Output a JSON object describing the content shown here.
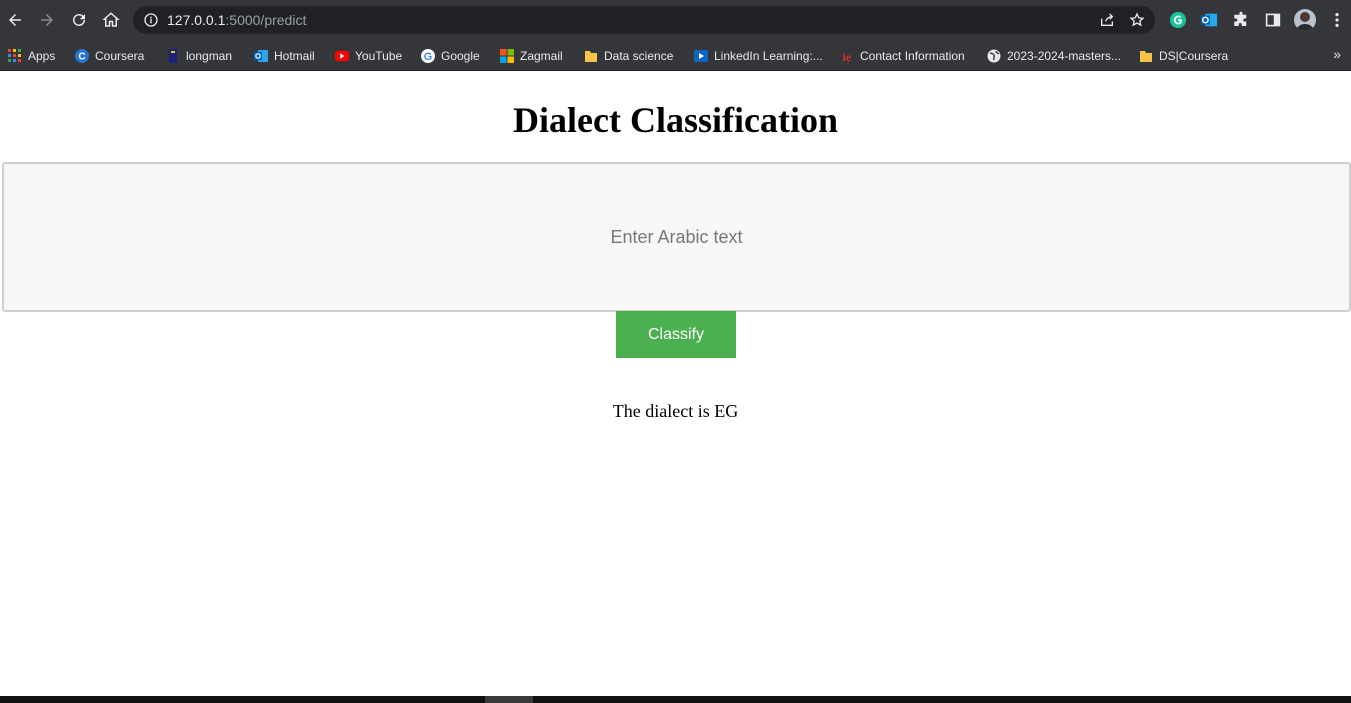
{
  "browser": {
    "url_host": "127.0.0.1",
    "url_path": ":5000/predict",
    "bookmarks": [
      {
        "label": "Apps",
        "icon": "apps-grid-icon"
      },
      {
        "label": "Coursera",
        "icon": "coursera-icon"
      },
      {
        "label": "longman",
        "icon": "longman-icon"
      },
      {
        "label": "Hotmail",
        "icon": "outlook-icon"
      },
      {
        "label": "YouTube",
        "icon": "youtube-icon"
      },
      {
        "label": "Google",
        "icon": "google-icon"
      },
      {
        "label": "Zagmail",
        "icon": "microsoft-icon"
      },
      {
        "label": "Data science",
        "icon": "folder-icon"
      },
      {
        "label": "LinkedIn Learning:...",
        "icon": "linkedin-learning-icon"
      },
      {
        "label": "Contact Information",
        "icon": "ie-icon"
      },
      {
        "label": "2023-2024-masters...",
        "icon": "globe-icon"
      },
      {
        "label": "DS|Coursera",
        "icon": "folder-icon"
      }
    ],
    "more": "»"
  },
  "page": {
    "title": "Dialect Classification",
    "input_placeholder": "Enter Arabic text",
    "button_label": "Classify",
    "result_text": "The dialect is EG"
  },
  "colors": {
    "toolbar": "#35363a",
    "button": "#4caf50"
  }
}
